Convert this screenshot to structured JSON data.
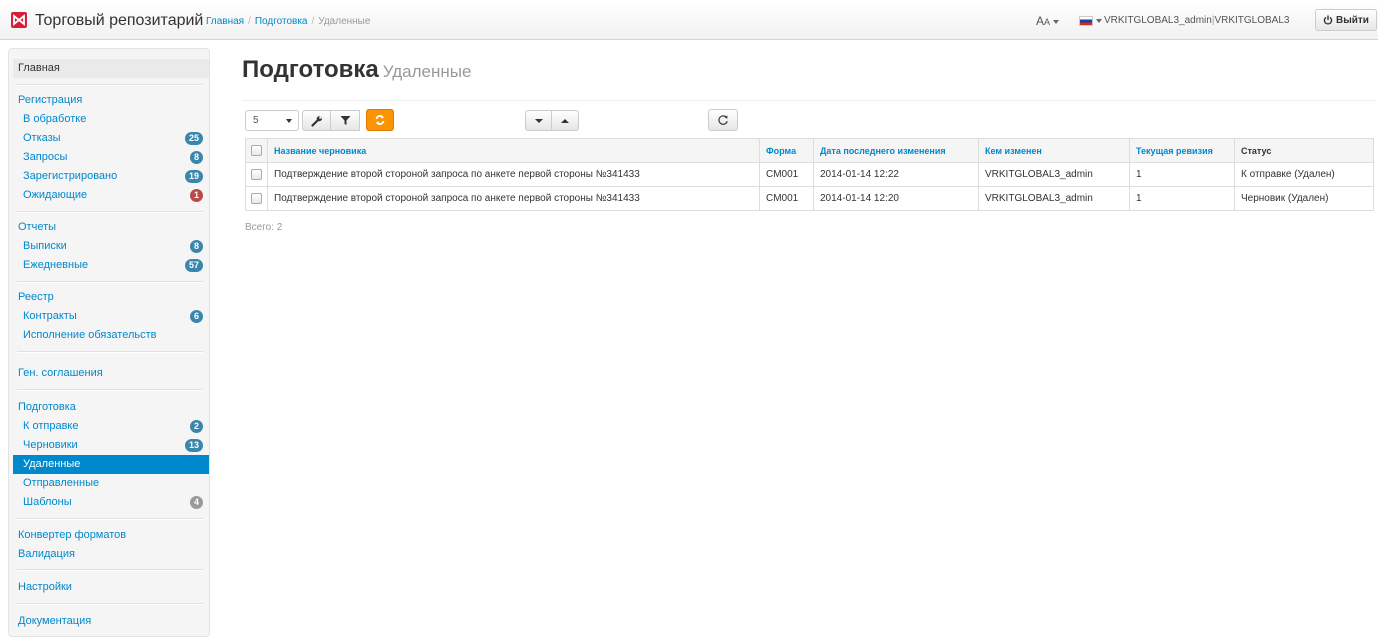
{
  "header": {
    "app_title": "Торговый репозитарий",
    "breadcrumb": [
      {
        "label": "Главная"
      },
      {
        "label": "Подготовка"
      },
      {
        "label": "Удаленные"
      }
    ],
    "font_menu_label": "A",
    "user_name": "VRKITGLOBAL3_admin",
    "org_name": "VRKITGLOBAL3",
    "logout_label": "Выйти",
    "brand_color": "#d6203a"
  },
  "sidebar": {
    "home": "Главная",
    "registration": {
      "title": "Регистрация",
      "items": [
        {
          "label": "В обработке"
        },
        {
          "label": "Отказы",
          "badge": "25"
        },
        {
          "label": "Запросы",
          "badge": "8"
        },
        {
          "label": "Зарегистрировано",
          "badge": "19"
        },
        {
          "label": "Ожидающие",
          "badge": "1"
        }
      ]
    },
    "reports": {
      "title": "Отчеты",
      "items": [
        {
          "label": "Выписки",
          "badge": "8"
        },
        {
          "label": "Ежедневные",
          "badge": "57"
        }
      ]
    },
    "registry": {
      "title": "Реестр",
      "items": [
        {
          "label": "Контракты",
          "badge": "6"
        },
        {
          "label": "Исполнение обязательств"
        }
      ]
    },
    "general_agreements": "Ген. соглашения",
    "preparation": {
      "title": "Подготовка",
      "items": [
        {
          "label": "К отправке",
          "badge": "2"
        },
        {
          "label": "Черновики",
          "badge": "13"
        },
        {
          "label": "Удаленные"
        },
        {
          "label": "Отправленные"
        },
        {
          "label": "Шаблоны",
          "badge": "4"
        }
      ]
    },
    "format_converter": "Конвертер форматов",
    "validation": "Валидация",
    "settings": "Настройки",
    "documentation": "Документация"
  },
  "main": {
    "title": "Подготовка",
    "subtitle": "Удаленные",
    "page_size": "5",
    "table": {
      "columns": [
        "Название черновика",
        "Форма",
        "Дата последнего изменения",
        "Кем изменен",
        "Текущая ревизия",
        "Статус"
      ],
      "rows": [
        {
          "name": "Подтверждение второй стороной запроса по анкете первой стороны №341433",
          "form": "CM001",
          "date": "2014-01-14 12:22",
          "changed_by": "VRKITGLOBAL3_admin",
          "revision": "1",
          "status": "К отправке (Удален)"
        },
        {
          "name": "Подтверждение второй стороной запроса по анкете первой стороны №341433",
          "form": "CM001",
          "date": "2014-01-14 12:20",
          "changed_by": "VRKITGLOBAL3_admin",
          "revision": "1",
          "status": "Черновик (Удален)"
        }
      ]
    },
    "total_label": "Всего: 2"
  },
  "colors": {
    "link": "#0088cc",
    "active": "#0088cc",
    "badge": "#3a87ad",
    "badge_alert": "#b94a48",
    "accent_button": "#f89406"
  },
  "icons": [
    "wrench-icon",
    "filter-icon",
    "refresh-icon",
    "caret-down-icon",
    "caret-up-icon",
    "reload-icon",
    "power-icon",
    "flag-ru-icon"
  ]
}
